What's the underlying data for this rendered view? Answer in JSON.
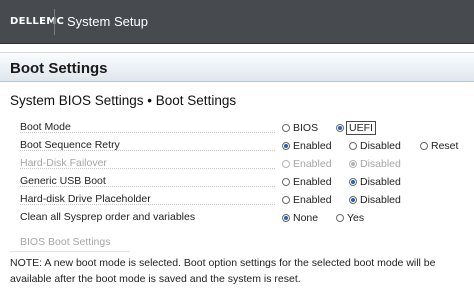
{
  "header": {
    "brand": "DELLEMC",
    "app_title": "System Setup"
  },
  "page_title": "Boot Settings",
  "section_title": "System BIOS Settings • Boot Settings",
  "settings": [
    {
      "label": "Boot Mode",
      "disabled": false,
      "options": [
        {
          "label": "BIOS",
          "selected": false
        },
        {
          "label": "UEFI",
          "selected": true,
          "focused": true
        }
      ]
    },
    {
      "label": "Boot Sequence Retry",
      "disabled": false,
      "options": [
        {
          "label": "Enabled",
          "selected": true
        },
        {
          "label": "Disabled",
          "selected": false
        },
        {
          "label": "Reset",
          "selected": false
        }
      ]
    },
    {
      "label": "Hard-Disk Failover",
      "disabled": true,
      "options": [
        {
          "label": "Enabled",
          "selected": false
        },
        {
          "label": "Disabled",
          "selected": true
        }
      ]
    },
    {
      "label": "Generic USB Boot",
      "disabled": false,
      "options": [
        {
          "label": "Enabled",
          "selected": false
        },
        {
          "label": "Disabled",
          "selected": true
        }
      ]
    },
    {
      "label": "Hard-disk Drive Placeholder",
      "disabled": false,
      "options": [
        {
          "label": "Enabled",
          "selected": false
        },
        {
          "label": "Disabled",
          "selected": true
        }
      ]
    },
    {
      "label": "Clean all Sysprep order and variables",
      "disabled": false,
      "options": [
        {
          "label": "None",
          "selected": true
        },
        {
          "label": "Yes",
          "selected": false
        }
      ]
    }
  ],
  "bios_boot_settings_link": "BIOS Boot Settings",
  "note": "NOTE: A new boot mode is selected. Boot option settings for the selected boot mode will be available after the boot mode is saved and the system is reset."
}
